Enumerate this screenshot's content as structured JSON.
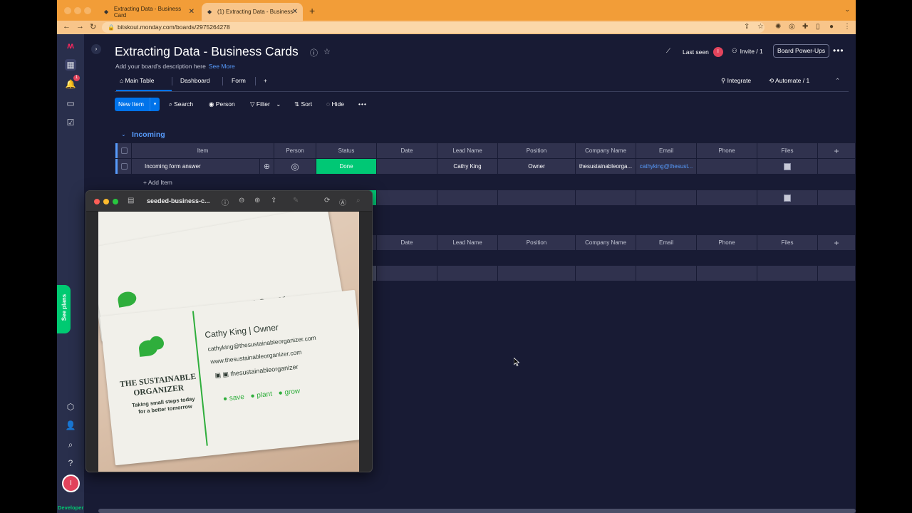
{
  "browser": {
    "tabs": [
      {
        "title": "Extracting Data - Business Card",
        "active": false
      },
      {
        "title": "(1) Extracting Data - Business",
        "active": true
      }
    ],
    "url": "bitskout.monday.com/boards/2975264278"
  },
  "rail": {
    "notifications_badge": "1",
    "see_plans": "See plans",
    "avatar_initial": "I",
    "developer": "Developer"
  },
  "board": {
    "title": "Extracting Data - Business Cards",
    "description": "Add your board's description here",
    "see_more": "See More",
    "last_seen": "Last seen",
    "last_seen_initial": "I",
    "invite": "Invite / 1",
    "power_ups": "Board Power-Ups"
  },
  "views": {
    "tabs": [
      "Main Table",
      "Dashboard",
      "Form"
    ],
    "add": "+",
    "integrate": "Integrate",
    "automate": "Automate / 1"
  },
  "toolbar": {
    "new_item": "New Item",
    "search": "Search",
    "person": "Person",
    "filter": "Filter",
    "sort": "Sort",
    "hide": "Hide"
  },
  "group": {
    "title": "Incoming",
    "columns": [
      "Item",
      "Person",
      "Status",
      "Date",
      "Lead Name",
      "Position",
      "Company Name",
      "Email",
      "Phone",
      "Files"
    ],
    "row": {
      "item": "Incoming form answer",
      "status": "Done",
      "lead_name": "Cathy King",
      "position": "Owner",
      "company": "thesustainableorga...",
      "email": "cathyking@thesust..."
    },
    "add_item": "+ Add Item"
  },
  "group2": {
    "columns": [
      "Date",
      "Lead Name",
      "Position",
      "Company Name",
      "Email",
      "Phone",
      "Files"
    ]
  },
  "preview": {
    "filename": "seeded-business-c...",
    "card": {
      "name_line": "Cathy King | Owner",
      "email": "cathyking@thesustainableorganizer.com",
      "website": "www.thesustainableorganizer.com",
      "social": "thesustainableorganizer",
      "brand_1": "THE SUSTAINABLE",
      "brand_2": "ORGANIZER",
      "tagline_1": "Taking small steps today",
      "tagline_2": "for a better tomorrow",
      "save": "save",
      "plant": "plant",
      "grow": "grow",
      "back_card_text": "y King | Owner"
    }
  },
  "colors": {
    "accent": "#0073ea",
    "done": "#00c875",
    "group": "#579bfc",
    "tab_strip": "#f29d38"
  }
}
